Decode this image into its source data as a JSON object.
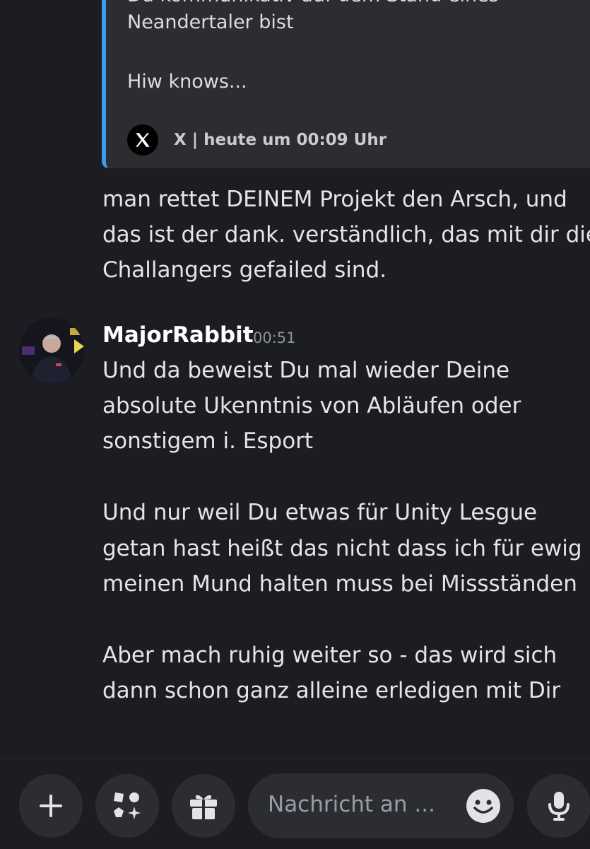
{
  "embed": {
    "cut_line": "Du kommunikativ auf dem Stand eines",
    "line2": "Neandertaler bist",
    "line3": "Hiw knows...",
    "source": "X | heute um 00:09 Uhr"
  },
  "reply": {
    "lines": [
      "man rettet DEINEM Projekt den Arsch, und",
      "das ist der dank. verständlich, das mit dir die",
      "Challangers gefailed sind."
    ]
  },
  "message": {
    "author": "MajorRabbit",
    "time": "00:51",
    "lines": [
      "Und da beweist Du mal wieder Deine",
      "absolute Ukenntnis von Abläufen oder",
      "sonstigem i. Esport",
      "",
      "Und nur weil Du etwas für Unity Lesgue",
      "getan hast heißt das nicht dass ich für ewig",
      "meinen Mund halten muss bei Missständen",
      "",
      "Aber mach ruhig weiter so - das wird sich",
      "dann schon ganz alleine erledigen mit Dir"
    ]
  },
  "composer": {
    "placeholder": "Nachricht an ...",
    "icons": [
      "plus-icon",
      "apps-icon",
      "gift-icon",
      "emoji-icon",
      "microphone-icon"
    ]
  },
  "colors": {
    "background": "#1c1d22",
    "embed_bg": "#2b2d31",
    "embed_accent": "#3b9cf2",
    "button_bg": "#2b2d33"
  }
}
